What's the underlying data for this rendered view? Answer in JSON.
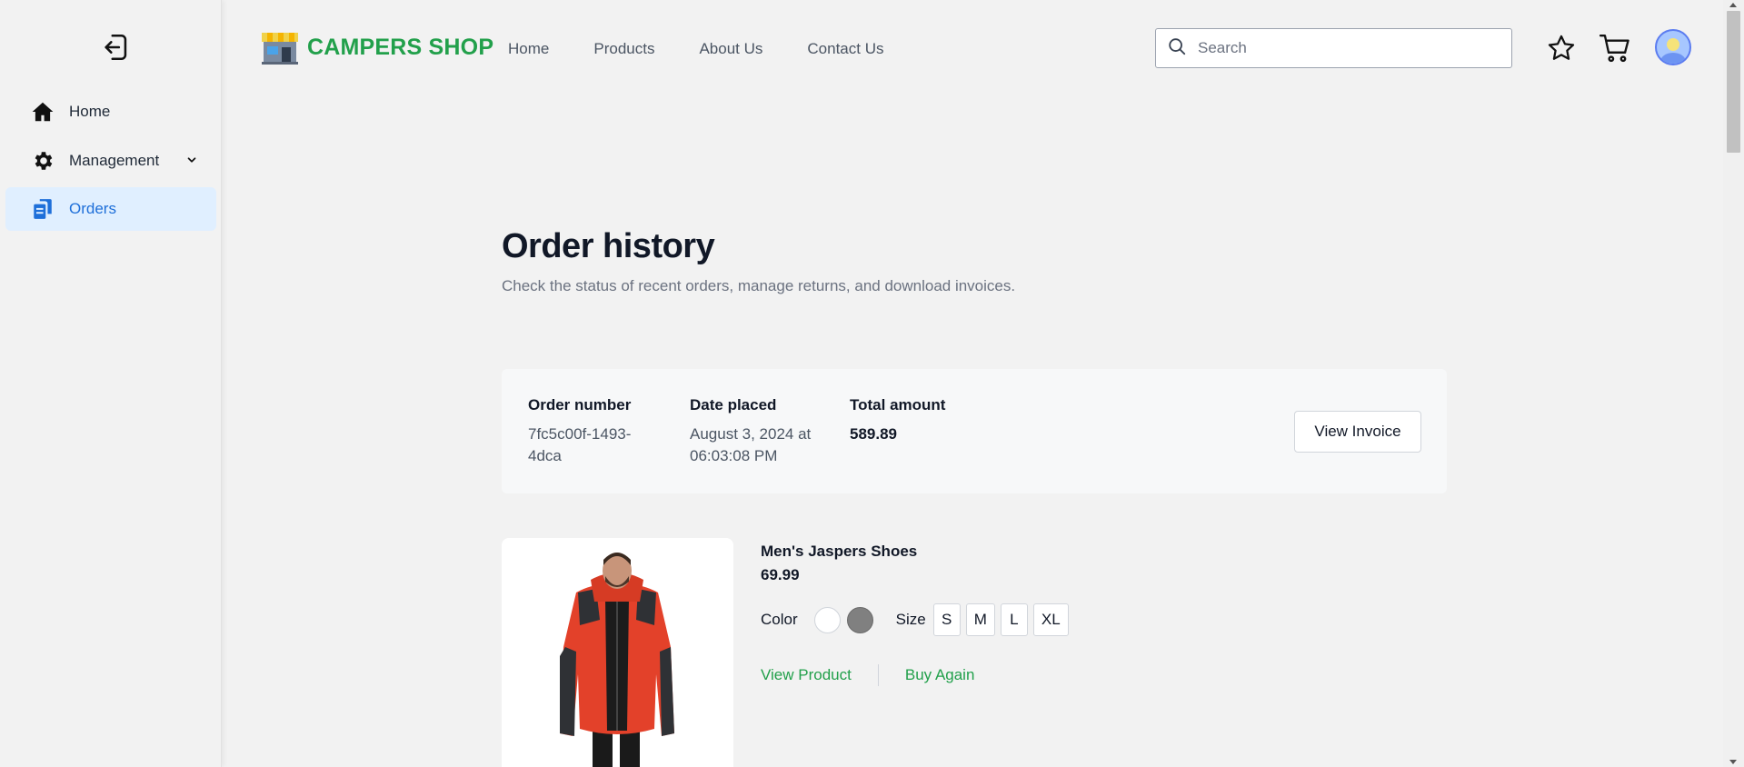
{
  "sidebar": {
    "items": [
      {
        "label": "Home",
        "icon": "home-icon"
      },
      {
        "label": "Management",
        "icon": "gear-icon"
      },
      {
        "label": "Orders",
        "icon": "orders-icon"
      }
    ]
  },
  "header": {
    "brand": "CAMPERS SHOP",
    "nav": [
      "Home",
      "Products",
      "About Us",
      "Contact Us"
    ],
    "search_placeholder": "Search"
  },
  "main": {
    "title": "Order history",
    "subtitle": "Check the status of recent orders, manage returns, and download invoices.",
    "order": {
      "number_label": "Order number",
      "number_line1": "7fc5c00f-1493-",
      "number_line2": "4dca",
      "date_label": "Date placed",
      "date_line1": "August 3, 2024 at",
      "date_line2": "06:03:08 PM",
      "total_label": "Total amount",
      "total_value": "589.89",
      "invoice_button": "View Invoice"
    },
    "product": {
      "name": "Men's Jaspers Shoes",
      "price": "69.99",
      "color_label": "Color",
      "colors": [
        "#ffffff",
        "#808080"
      ],
      "size_label": "Size",
      "sizes": [
        "S",
        "M",
        "L",
        "XL"
      ],
      "view_link": "View Product",
      "buy_link": "Buy Again"
    }
  },
  "colors": {
    "brand_green": "#22a04b",
    "active_blue": "#1e6fd9",
    "active_bg": "#e0efff"
  }
}
